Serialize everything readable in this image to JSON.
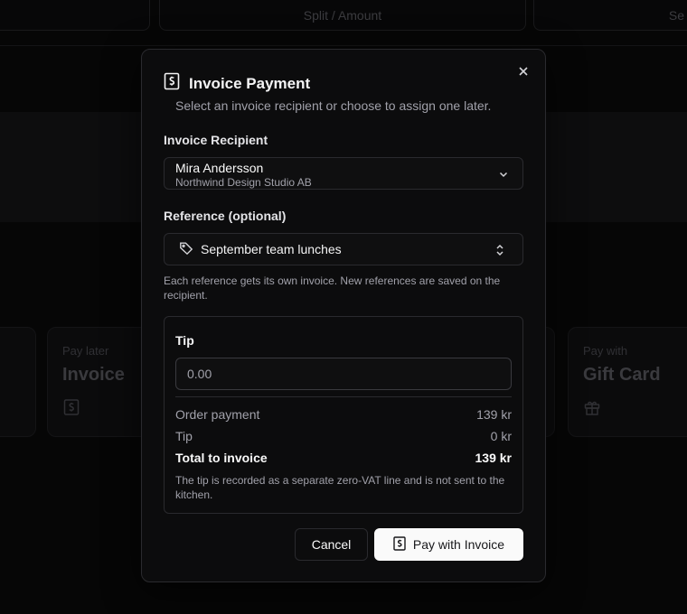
{
  "background": {
    "tabs": [
      "",
      "Split / Amount",
      "Se"
    ],
    "cards": [
      {
        "small": "",
        "big": ""
      },
      {
        "small": "Pay later",
        "big": "Invoice",
        "icon": "receipt-icon"
      },
      {
        "small": "Pay with",
        "big": "Gift Card",
        "icon": "gift-icon"
      }
    ]
  },
  "dialog": {
    "title": "Invoice Payment",
    "subtitle": "Select an invoice recipient or choose to assign one later.",
    "recipient": {
      "label": "Invoice Recipient",
      "name": "Mira Andersson",
      "company": "Northwind Design Studio AB"
    },
    "reference": {
      "label": "Reference (optional)",
      "value": "September team lunches",
      "help": "Each reference gets its own invoice. New references are saved on the recipient."
    },
    "tip": {
      "label": "Tip",
      "placeholder": "0.00",
      "summary": {
        "order_label": "Order payment",
        "order_value": "139 kr",
        "tip_label": "Tip",
        "tip_value": "0 kr",
        "total_label": "Total to invoice",
        "total_value": "139 kr"
      },
      "note": "The tip is recorded as a separate zero-VAT line and is not sent to the kitchen."
    },
    "buttons": {
      "cancel": "Cancel",
      "pay": "Pay with Invoice"
    }
  },
  "colors": {
    "background": "#0a0a0a",
    "dialog": "#0c0c0d",
    "border": "#2a2a2e",
    "primary_button": "#fafafa",
    "muted_text": "#a1a1aa"
  }
}
